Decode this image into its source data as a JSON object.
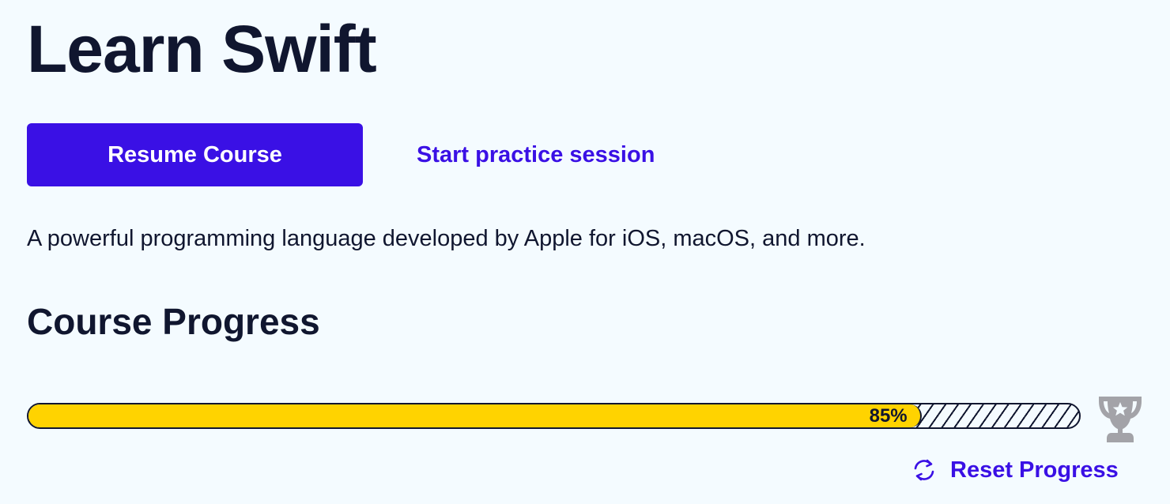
{
  "header": {
    "title": "Learn Swift"
  },
  "actions": {
    "resume_label": "Resume Course",
    "practice_label": "Start practice session"
  },
  "description": "A powerful programming language developed by Apple for iOS, macOS, and more.",
  "progress": {
    "section_title": "Course Progress",
    "percent": 85,
    "percent_label": "85%",
    "reset_label": "Reset Progress"
  },
  "icons": {
    "trophy": "trophy-icon",
    "reset": "refresh-icon"
  },
  "colors": {
    "background": "#f4fbff",
    "text": "#10162f",
    "primary": "#3a10e5",
    "progress_fill": "#ffd300",
    "trophy": "#a3a3a8"
  }
}
